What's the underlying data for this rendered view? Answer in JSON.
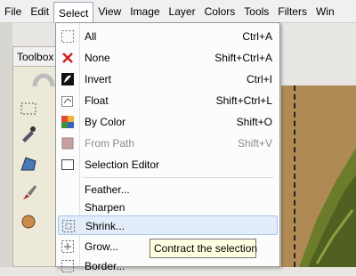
{
  "menubar": {
    "items": [
      "File",
      "Edit",
      "Select",
      "View",
      "Image",
      "Layer",
      "Colors",
      "Tools",
      "Filters",
      "Win"
    ]
  },
  "toolbox": {
    "title": "Toolbox"
  },
  "select_menu": {
    "items": [
      {
        "label": "All",
        "shortcut": "Ctrl+A",
        "icon": "select-all-icon",
        "enabled": true
      },
      {
        "label": "None",
        "shortcut": "Shift+Ctrl+A",
        "icon": "select-none-icon",
        "enabled": true
      },
      {
        "label": "Invert",
        "shortcut": "Ctrl+I",
        "icon": "invert-icon",
        "enabled": true
      },
      {
        "label": "Float",
        "shortcut": "Shift+Ctrl+L",
        "icon": "float-icon",
        "enabled": true
      },
      {
        "label": "By Color",
        "shortcut": "Shift+O",
        "icon": "by-color-icon",
        "enabled": true
      },
      {
        "label": "From Path",
        "shortcut": "Shift+V",
        "icon": "from-path-icon",
        "enabled": false
      },
      {
        "label": "Selection Editor",
        "shortcut": "",
        "icon": "selection-editor-icon",
        "enabled": true
      },
      {
        "label": "Feather...",
        "shortcut": "",
        "icon": "",
        "enabled": true
      },
      {
        "label": "Sharpen",
        "shortcut": "",
        "icon": "",
        "enabled": true
      },
      {
        "label": "Shrink...",
        "shortcut": "",
        "icon": "shrink-icon",
        "enabled": true,
        "highlighted": true
      },
      {
        "label": "Grow...",
        "shortcut": "",
        "icon": "grow-icon",
        "enabled": true
      },
      {
        "label": "Border...",
        "shortcut": "",
        "icon": "border-icon",
        "enabled": true
      }
    ]
  },
  "tooltip": {
    "text": "Contract the selection"
  },
  "colors": {
    "menu_highlight": "#e3edf9",
    "canvas_tan": "#b08a55",
    "foliage": "#6b7d2a"
  }
}
